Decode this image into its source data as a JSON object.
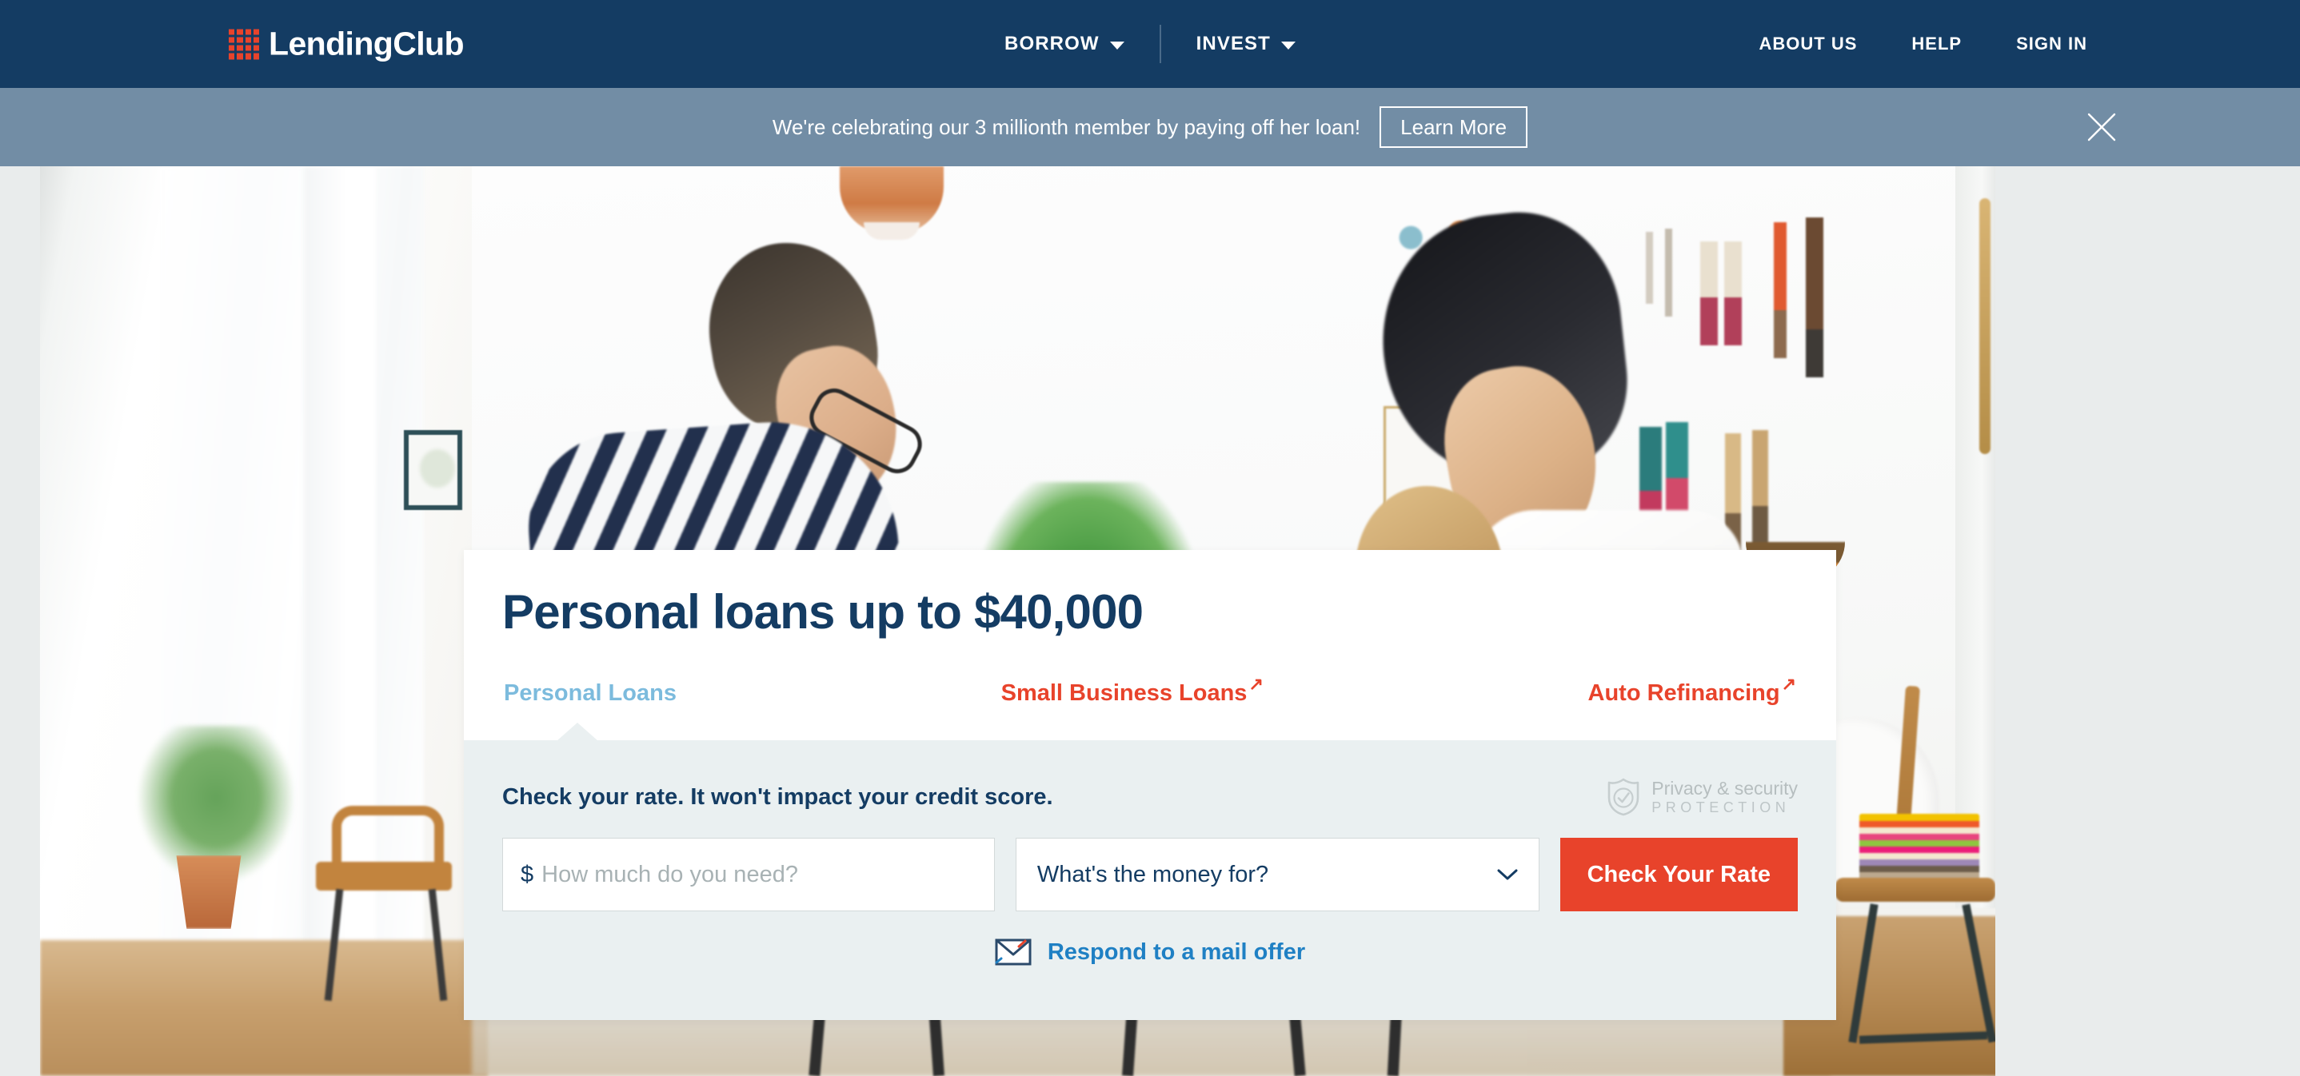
{
  "nav": {
    "logo_text": "LendingClub",
    "logo_icon": "lendingclub-grid-logo",
    "primary": [
      {
        "label": "BORROW",
        "icon": "chevron-down-icon"
      },
      {
        "label": "INVEST",
        "icon": "chevron-down-icon"
      }
    ],
    "secondary": [
      {
        "label": "ABOUT US"
      },
      {
        "label": "HELP"
      },
      {
        "label": "SIGN IN"
      }
    ]
  },
  "banner": {
    "message": "We're celebrating our 3 millionth member by paying off her loan!",
    "button_label": "Learn More",
    "close_icon": "close-icon",
    "background_color": "#728da5"
  },
  "hero": {
    "image_description": "Family at a bright white dining table: man in navy striped shirt with glasses, woman in white tank top, blonde child drawing with colored pencils, potted plant, copper pendant lamp, feather earrings on wall"
  },
  "card": {
    "title": "Personal loans up to $40,000",
    "tabs": [
      {
        "label": "Personal Loans",
        "state": "active",
        "external": false
      },
      {
        "label": "Small Business Loans",
        "state": "inactive",
        "external": true
      },
      {
        "label": "Auto Refinancing",
        "state": "inactive",
        "external": true
      }
    ],
    "external_arrow": "↗",
    "subhead": "Check your rate. It won't impact your credit score.",
    "privacy_badge": {
      "icon": "shield-check-icon",
      "line1": "Privacy & security",
      "line2": "PROTECTION"
    },
    "form": {
      "amount": {
        "prefix": "$",
        "value": "",
        "placeholder": "How much do you need?"
      },
      "purpose": {
        "selected": "What's the money for?",
        "icon": "chevron-down-icon"
      },
      "submit_label": "Check Your Rate"
    },
    "mail_offer": {
      "icon": "envelope-icon",
      "label": "Respond to a mail offer"
    }
  },
  "colors": {
    "nav_navy": "#143c63",
    "banner_blue": "#728da5",
    "accent_red": "#e8432b",
    "tab_active_blue": "#7cbbdd",
    "link_blue": "#1f80c4",
    "panel_gray": "#eaf0f1"
  }
}
